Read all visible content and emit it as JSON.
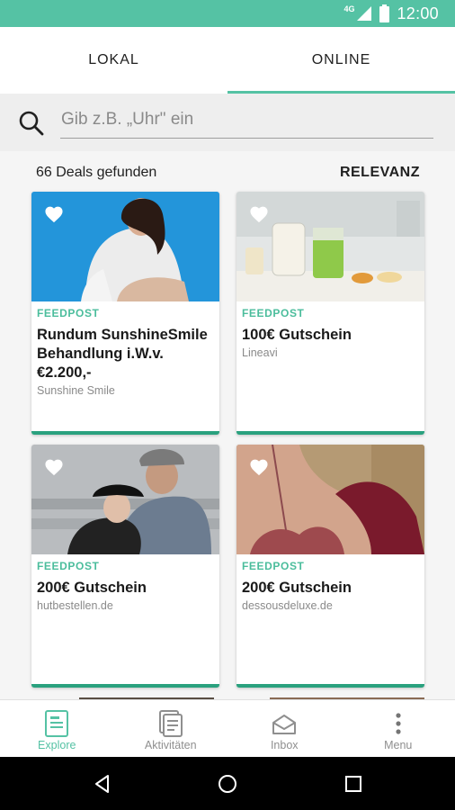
{
  "status_bar": {
    "network": "4G",
    "time": "12:00",
    "accent": "#55c2a4"
  },
  "tabs": [
    {
      "label": "LOKAL",
      "active": false
    },
    {
      "label": "ONLINE",
      "active": true
    }
  ],
  "search": {
    "placeholder": "Gib z.B. „Uhr\" ein",
    "value": "",
    "icon": "search-icon"
  },
  "results": {
    "count_text": "66 Deals gefunden",
    "sort_label": "RELEVANZ"
  },
  "deals": [
    {
      "tag": "FEEDPOST",
      "title": "Rundum SunshineSmile Behandlung i.W.v. €2.200,-",
      "merchant": "Sunshine Smile",
      "favorite_icon": "heart-icon"
    },
    {
      "tag": "FEEDPOST",
      "title": "100€ Gutschein",
      "merchant": "Lineavi",
      "favorite_icon": "heart-icon"
    },
    {
      "tag": "FEEDPOST",
      "title": "200€ Gutschein",
      "merchant": "hutbestellen.de",
      "favorite_icon": "heart-icon"
    },
    {
      "tag": "FEEDPOST",
      "title": "200€ Gutschein",
      "merchant": "dessousdeluxe.de",
      "favorite_icon": "heart-icon"
    }
  ],
  "bottom_nav": [
    {
      "label": "Explore",
      "icon": "explore-icon",
      "active": true
    },
    {
      "label": "Aktivitäten",
      "icon": "activities-icon",
      "active": false
    },
    {
      "label": "Inbox",
      "icon": "inbox-icon",
      "active": false
    },
    {
      "label": "Menu",
      "icon": "menu-dots-icon",
      "active": false
    }
  ],
  "system_nav": {
    "back_icon": "back-icon",
    "home_icon": "home-icon",
    "recents_icon": "recents-icon"
  },
  "colors": {
    "accent": "#55c2a4",
    "card_bar": "#2aa17e",
    "tag": "#4bbd9c"
  }
}
